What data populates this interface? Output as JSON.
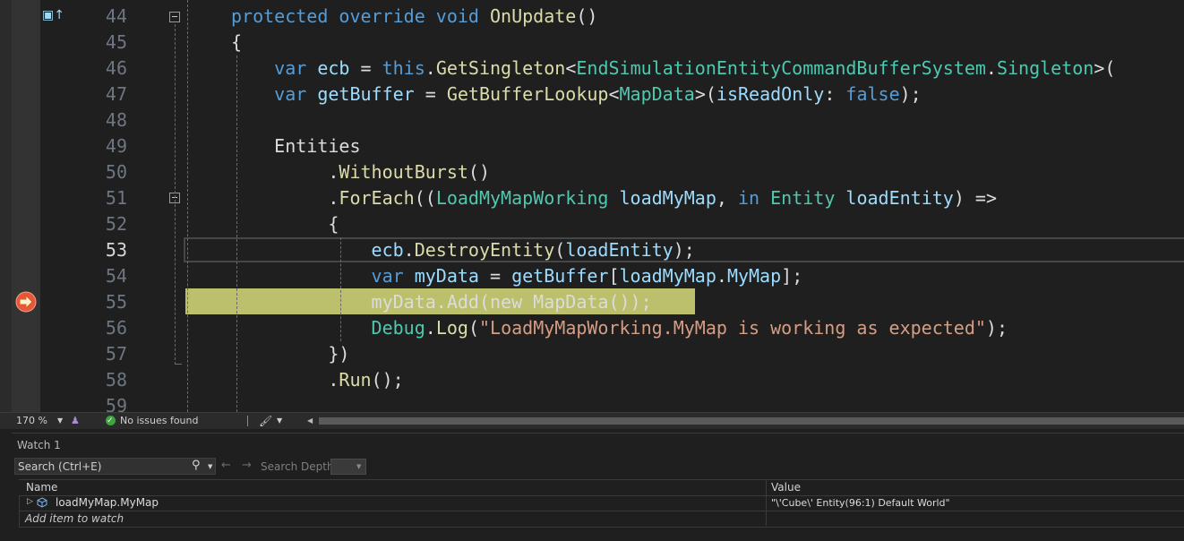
{
  "editor": {
    "lines": [
      {
        "num": "44",
        "tokens": [
          [
            "protected",
            "kw"
          ],
          [
            " ",
            "pl"
          ],
          [
            "override",
            "kw"
          ],
          [
            " ",
            "pl"
          ],
          [
            "void",
            "kw"
          ],
          [
            " ",
            "pl"
          ],
          [
            "OnUpdate",
            "me"
          ],
          [
            "()",
            "pl"
          ]
        ]
      },
      {
        "num": "45",
        "tokens": [
          [
            "{",
            "pl"
          ]
        ]
      },
      {
        "num": "46",
        "tokens": [
          [
            "    ",
            "pl"
          ],
          [
            "var",
            "kw"
          ],
          [
            " ",
            "pl"
          ],
          [
            "ecb",
            "va"
          ],
          [
            " = ",
            "pl"
          ],
          [
            "this",
            "kw"
          ],
          [
            ".",
            "pl"
          ],
          [
            "GetSingleton",
            "me"
          ],
          [
            "<",
            "pl"
          ],
          [
            "EndSimulationEntityCommandBufferSystem",
            "ty"
          ],
          [
            ".",
            "pl"
          ],
          [
            "Singleton",
            "ty"
          ],
          [
            ">(",
            "pl"
          ]
        ]
      },
      {
        "num": "47",
        "tokens": [
          [
            "    ",
            "pl"
          ],
          [
            "var",
            "kw"
          ],
          [
            " ",
            "pl"
          ],
          [
            "getBuffer",
            "va"
          ],
          [
            " = ",
            "pl"
          ],
          [
            "GetBufferLookup",
            "me"
          ],
          [
            "<",
            "pl"
          ],
          [
            "MapData",
            "ty"
          ],
          [
            ">(",
            "pl"
          ],
          [
            "isReadOnly",
            "va"
          ],
          [
            ": ",
            "pl"
          ],
          [
            "false",
            "kw"
          ],
          [
            ");",
            "pl"
          ]
        ]
      },
      {
        "num": "48",
        "tokens": []
      },
      {
        "num": "49",
        "tokens": [
          [
            "    ",
            "pl"
          ],
          [
            "Entities",
            "pl"
          ]
        ]
      },
      {
        "num": "50",
        "tokens": [
          [
            "         ",
            "pl"
          ],
          [
            ".",
            "pl"
          ],
          [
            "WithoutBurst",
            "me"
          ],
          [
            "()",
            "pl"
          ]
        ]
      },
      {
        "num": "51",
        "tokens": [
          [
            "         ",
            "pl"
          ],
          [
            ".",
            "pl"
          ],
          [
            "ForEach",
            "me"
          ],
          [
            "((",
            "pl"
          ],
          [
            "LoadMyMapWorking",
            "ty"
          ],
          [
            " ",
            "pl"
          ],
          [
            "loadMyMap",
            "va"
          ],
          [
            ", ",
            "pl"
          ],
          [
            "in",
            "kw"
          ],
          [
            " ",
            "pl"
          ],
          [
            "Entity",
            "ty"
          ],
          [
            " ",
            "pl"
          ],
          [
            "loadEntity",
            "va"
          ],
          [
            ") =>",
            "pl"
          ]
        ]
      },
      {
        "num": "52",
        "tokens": [
          [
            "         ",
            "pl"
          ],
          [
            "{",
            "pl"
          ]
        ]
      },
      {
        "num": "53",
        "tokens": [
          [
            "             ",
            "pl"
          ],
          [
            "ecb",
            "va"
          ],
          [
            ".",
            "pl"
          ],
          [
            "DestroyEntity",
            "me"
          ],
          [
            "(",
            "pl"
          ],
          [
            "loadEntity",
            "va"
          ],
          [
            ");",
            "pl"
          ]
        ]
      },
      {
        "num": "54",
        "tokens": [
          [
            "             ",
            "pl"
          ],
          [
            "var",
            "kw"
          ],
          [
            " ",
            "pl"
          ],
          [
            "myData",
            "va"
          ],
          [
            " = ",
            "pl"
          ],
          [
            "getBuffer",
            "va"
          ],
          [
            "[",
            "pl"
          ],
          [
            "loadMyMap",
            "va"
          ],
          [
            ".",
            "pl"
          ],
          [
            "MyMap",
            "va"
          ],
          [
            "];",
            "pl"
          ]
        ]
      },
      {
        "num": "55",
        "tokens": [
          [
            "             ",
            "pl"
          ],
          [
            "myData.Add(new MapData());",
            "pl"
          ]
        ]
      },
      {
        "num": "56",
        "tokens": [
          [
            "             ",
            "pl"
          ],
          [
            "Debug",
            "ty"
          ],
          [
            ".",
            "pl"
          ],
          [
            "Log",
            "me"
          ],
          [
            "(",
            "pl"
          ],
          [
            "\"LoadMyMapWorking.MyMap is working as expected\"",
            "st"
          ],
          [
            ");",
            "pl"
          ]
        ]
      },
      {
        "num": "57",
        "tokens": [
          [
            "         ",
            "pl"
          ],
          [
            "})",
            "pl"
          ]
        ]
      },
      {
        "num": "58",
        "tokens": [
          [
            "         ",
            "pl"
          ],
          [
            ".",
            "pl"
          ],
          [
            "Run",
            "me"
          ],
          [
            "();",
            "pl"
          ]
        ]
      },
      {
        "num": "59",
        "tokens": []
      }
    ],
    "current_line": "53",
    "execution_line": "55",
    "zoom": "170 %",
    "issues": "No issues found"
  },
  "watch": {
    "title": "Watch 1",
    "search_placeholder": "Search (Ctrl+E)",
    "search_depth_label": "Search Depth:",
    "columns": {
      "name": "Name",
      "value": "Value"
    },
    "rows": [
      {
        "name": "loadMyMap.MyMap",
        "value": "\"\\'Cube\\' Entity(96:1) Default World\""
      }
    ],
    "add_item": "Add item to watch"
  }
}
